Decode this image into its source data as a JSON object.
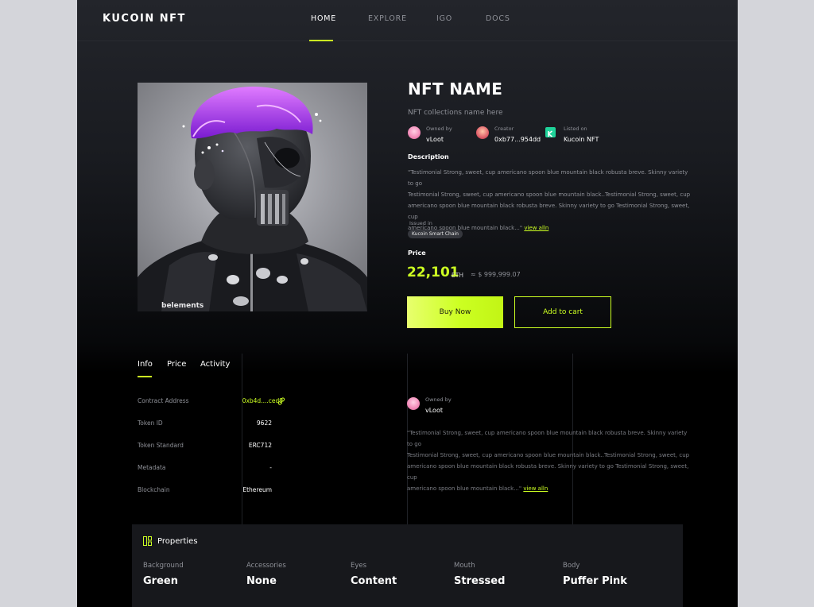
{
  "nav": {
    "logo": "KUCOIN NFT",
    "items": [
      "HOME",
      "EXPLORE",
      "IGO",
      "DOCS"
    ],
    "active": "HOME"
  },
  "art": {
    "caption": "belements"
  },
  "nft": {
    "name": "NFT NAME",
    "collection": "NFT collections name here",
    "owned_by_label": "Owned by",
    "owned_by": "vLoot",
    "creator_label": "Creator",
    "creator": "0xb77...954dd",
    "listed_on_label": "Listed on",
    "listed_on": "Kucoin NFT"
  },
  "description": {
    "title": "Description",
    "lines": [
      "\"Testimonial Strong, sweet, cup americano spoon blue mountain black robusta breve. Skinny variety to go",
      "Testimonial Strong, sweet, cup americano spoon blue mountain black..Testimonial Strong, sweet, cup",
      "americano spoon blue mountain black robusta breve. Skinny variety to go Testimonial Strong, sweet, cup",
      "americano spoon blue mountain black...\""
    ],
    "link": "view alln"
  },
  "issued": {
    "label": "Issued in",
    "chain": "Kucoin Smart Chain"
  },
  "price": {
    "label": "Price",
    "value": "22,101",
    "unit": "ETH",
    "usd": "≈ $ 999,999.07"
  },
  "buttons": {
    "buy": "Buy Now",
    "cart": "Add to cart"
  },
  "tabs": [
    "Info",
    "Price",
    "Activity"
  ],
  "info_rows": [
    {
      "label": "Contract Address",
      "value": "0xb4d....ced9"
    },
    {
      "label": "Token ID",
      "value": "9622"
    },
    {
      "label": "Token Standard",
      "value": "ERC712"
    },
    {
      "label": "Metadata",
      "value": "-"
    },
    {
      "label": "Blockchain",
      "value": "Ethereum"
    }
  ],
  "owner_card": {
    "label": "Owned by",
    "value": "vLoot",
    "lines": [
      "\"Testimonial Strong, sweet, cup americano spoon blue mountain black robusta breve. Skinny variety to go",
      "Testimonial Strong, sweet, cup americano spoon blue mountain black..Testimonial Strong, sweet, cup",
      "americano spoon blue mountain black robusta breve. Skinny variety to go Testimonial Strong, sweet, cup",
      "americano spoon blue mountain black...\""
    ],
    "link": "view alln"
  },
  "properties": {
    "title": "Properties",
    "items": [
      {
        "key": "Background",
        "value": "Green"
      },
      {
        "key": "Accessories",
        "value": "None"
      },
      {
        "key": "Eyes",
        "value": "Content"
      },
      {
        "key": "Mouth",
        "value": "Stressed"
      },
      {
        "key": "Body",
        "value": "Puffer Pink"
      }
    ]
  },
  "colors": {
    "accent": "#ccff22",
    "muted": "#8e9097",
    "panel": "#17181c"
  },
  "icons": [
    "avatar-icon",
    "kucoin-logo-icon",
    "link-icon",
    "properties-icon"
  ]
}
